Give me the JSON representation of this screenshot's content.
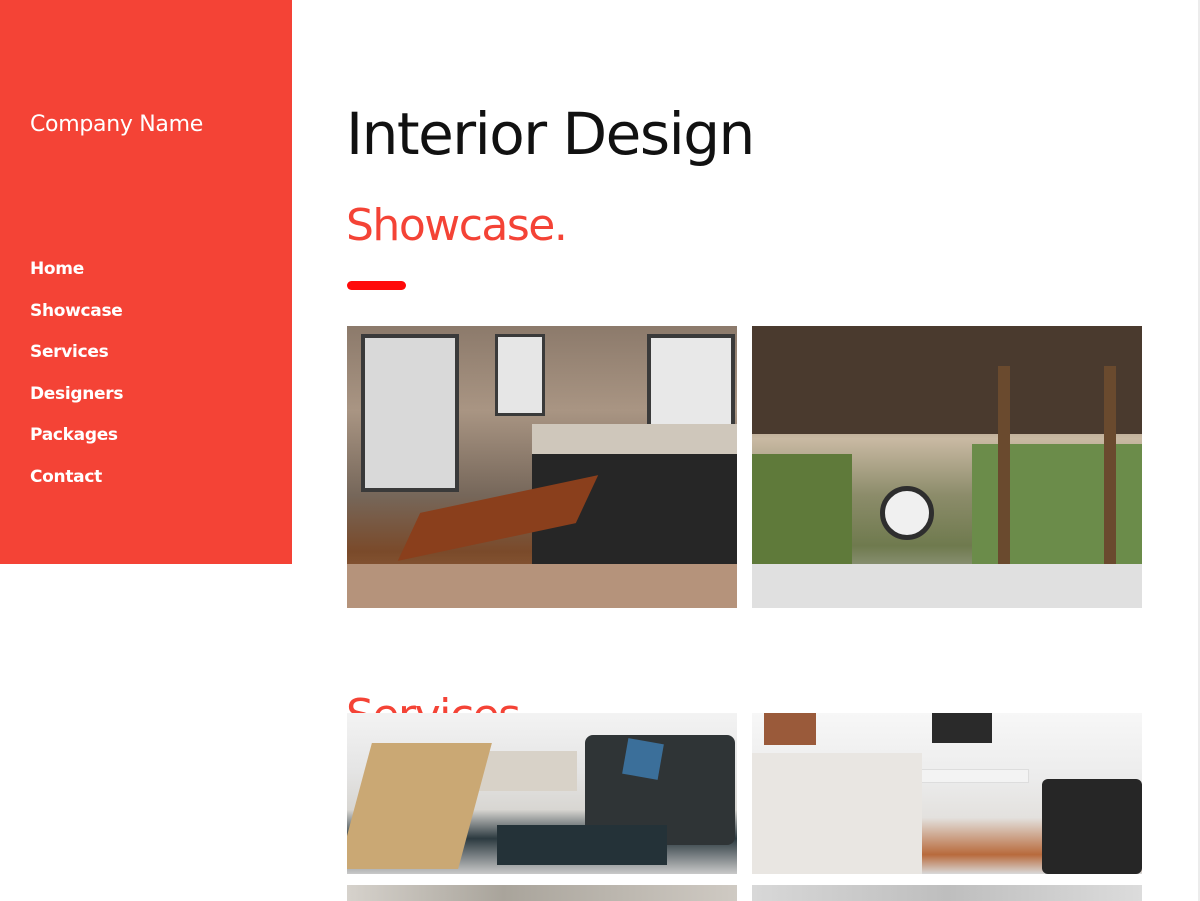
{
  "sidebar": {
    "company_name": "Company Name",
    "nav": [
      {
        "label": "Home"
      },
      {
        "label": "Showcase"
      },
      {
        "label": "Services"
      },
      {
        "label": "Designers"
      },
      {
        "label": "Packages"
      },
      {
        "label": "Contact"
      }
    ]
  },
  "main": {
    "title": "Interior Design",
    "subtitle": "Showcase.",
    "services_heading": "Services"
  },
  "colors": {
    "accent": "#f44336",
    "accent_bar": "#ff0a0a",
    "title_text": "#111111",
    "sidebar_text": "#ffffff"
  },
  "photos": [
    {
      "name": "loft-kitchen-photo"
    },
    {
      "name": "patio-living-room-photo"
    },
    {
      "name": "living-room-sofa-photo"
    },
    {
      "name": "bedroom-desk-photo"
    }
  ]
}
